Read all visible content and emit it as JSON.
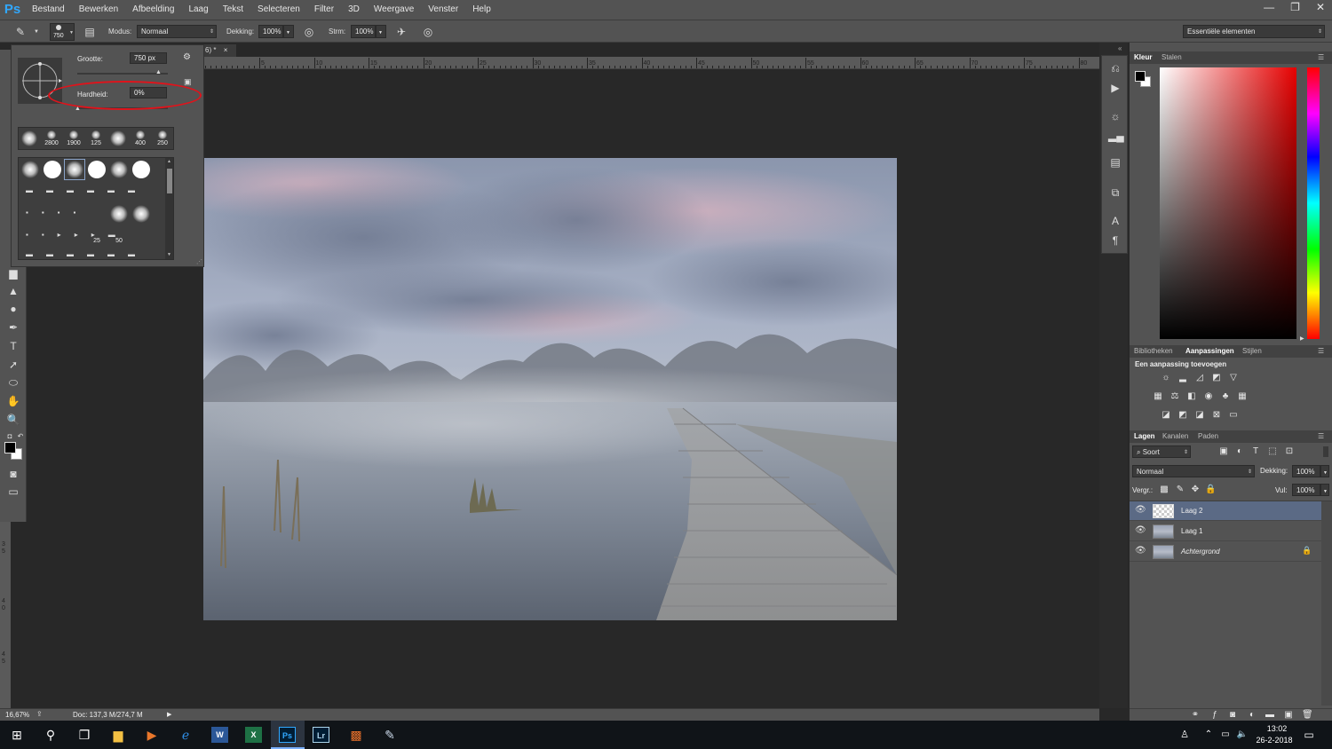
{
  "menubar": {
    "app_logo": "Ps",
    "items": [
      "Bestand",
      "Bewerken",
      "Afbeelding",
      "Laag",
      "Tekst",
      "Selecteren",
      "Filter",
      "3D",
      "Weergave",
      "Venster",
      "Help"
    ],
    "window_controls": [
      "—",
      "❐",
      "✕"
    ]
  },
  "options": {
    "brush_size": "750",
    "mode_label": "Modus:",
    "mode_value": "Normaal",
    "opacity_label": "Dekking:",
    "opacity_value": "100%",
    "flow_label": "Strm:",
    "flow_value": "100%",
    "workspace": "Essentiële elementen"
  },
  "brush_popup": {
    "size_label": "Grootte:",
    "size_value": "750 px",
    "hardness_label": "Hardheid:",
    "hardness_value": "0%",
    "recent_sizes": [
      "2800",
      "1900",
      "125",
      "400",
      "250"
    ],
    "grid_numbers": [
      "25",
      "50"
    ],
    "annotation_color": "#e0131b"
  },
  "document": {
    "tab_label": "6) *",
    "tab_close": "×",
    "ruler_ticks": [
      "5",
      "10",
      "15",
      "20",
      "25",
      "30",
      "35",
      "40",
      "45",
      "50",
      "55",
      "60",
      "65",
      "70",
      "75",
      "80"
    ],
    "vruler_ticks": [
      "3",
      "5",
      "4",
      "0",
      "4",
      "5"
    ]
  },
  "status": {
    "zoom": "16,67%",
    "doc_info": "Doc: 137,3 M/274,7 M"
  },
  "panels": {
    "color_tabs": [
      "Kleur",
      "Stalen"
    ],
    "adjust_tabs": [
      "Bibliotheken",
      "Aanpassingen",
      "Stijlen"
    ],
    "adjust_title": "Een aanpassing toevoegen",
    "layers_tabs": [
      "Lagen",
      "Kanalen",
      "Paden"
    ],
    "filter_kind": "Soort",
    "blend_mode": "Normaal",
    "opacity_label": "Dekking:",
    "opacity_value": "100%",
    "lock_label": "Vergr.:",
    "fill_label": "Vul:",
    "fill_value": "100%",
    "layers": [
      {
        "name": "Laag 2",
        "selected": true
      },
      {
        "name": "Laag 1",
        "selected": false
      },
      {
        "name": "Achtergrond",
        "selected": false,
        "locked": true
      }
    ]
  },
  "taskbar": {
    "time": "13:02",
    "date": "26-2-2018",
    "apps": [
      "W",
      "X",
      "Ps",
      "Lr"
    ]
  },
  "colors": {
    "ps_blue": "#31a8ff",
    "selected_layer": "#5b6a85",
    "panel_bg": "#535353"
  }
}
